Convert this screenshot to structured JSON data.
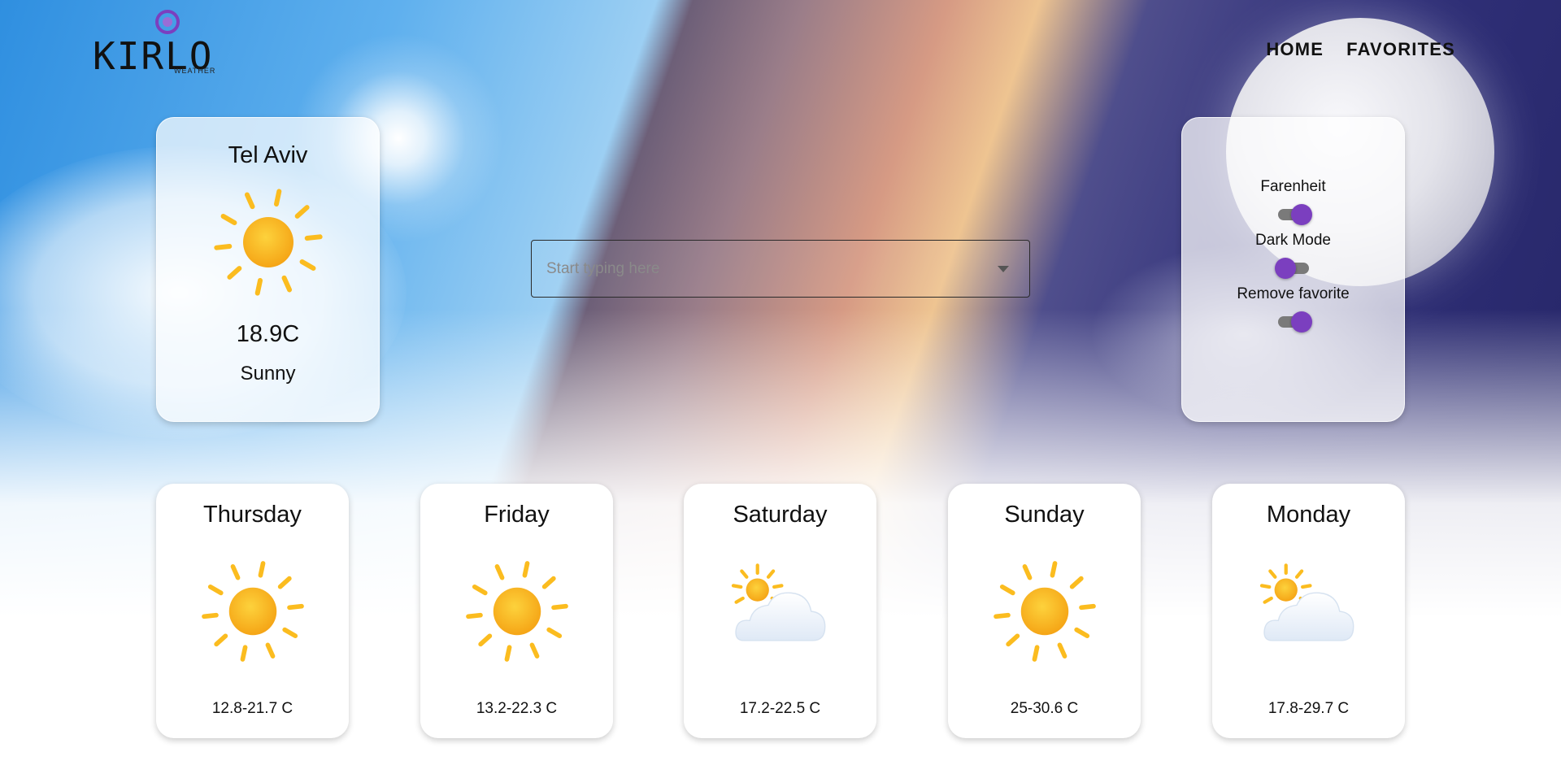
{
  "header": {
    "logo_text": "KIRLO",
    "logo_subtext": "WEATHER",
    "nav": [
      {
        "label": "HOME"
      },
      {
        "label": "FAVORITES"
      }
    ]
  },
  "current": {
    "city": "Tel Aviv",
    "icon": "sun-icon",
    "temperature": "18.9C",
    "condition": "Sunny"
  },
  "search": {
    "placeholder": "Start typing here",
    "value": ""
  },
  "settings": {
    "items": [
      {
        "label": "Farenheit",
        "on": true
      },
      {
        "label": "Dark Mode",
        "on": false
      },
      {
        "label": "Remove favorite",
        "on": true
      }
    ]
  },
  "forecast": [
    {
      "day": "Thursday",
      "icon": "sun-icon",
      "range": "12.8-21.7 C"
    },
    {
      "day": "Friday",
      "icon": "sun-icon",
      "range": "13.2-22.3 C"
    },
    {
      "day": "Saturday",
      "icon": "partly-cloudy-icon",
      "range": "17.2-22.5 C"
    },
    {
      "day": "Sunday",
      "icon": "sun-icon",
      "range": "25-30.6 C"
    },
    {
      "day": "Monday",
      "icon": "partly-cloudy-icon",
      "range": "17.8-29.7 C"
    }
  ],
  "colors": {
    "accent": "#7b3fbf",
    "sun": "#fbbc1f",
    "cloud": "#eef4fb"
  }
}
